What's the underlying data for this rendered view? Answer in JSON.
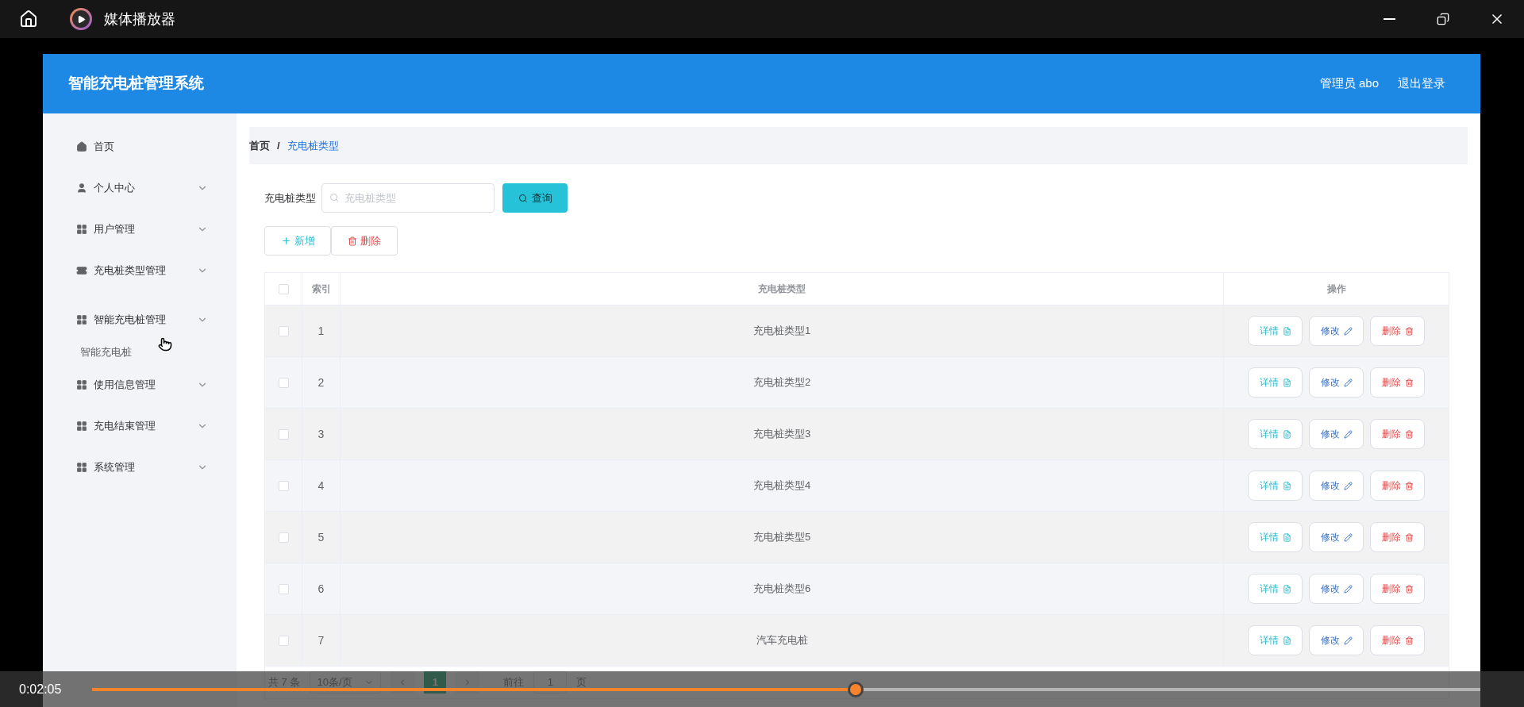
{
  "window": {
    "title": "媒体播放器"
  },
  "app": {
    "title": "智能充电桩管理系统",
    "user": "管理员 abo",
    "logout": "退出登录"
  },
  "sidebar": {
    "items": [
      {
        "label": "首页",
        "kind": "home"
      },
      {
        "label": "个人中心",
        "kind": "user"
      },
      {
        "label": "用户管理",
        "kind": "grid"
      },
      {
        "label": "充电桩类型管理",
        "kind": "ticket"
      },
      {
        "label": "智能充电桩管理",
        "kind": "grid",
        "children": [
          {
            "label": "智能充电桩"
          }
        ]
      },
      {
        "label": "使用信息管理",
        "kind": "grid"
      },
      {
        "label": "充电结束管理",
        "kind": "grid"
      },
      {
        "label": "系统管理",
        "kind": "grid"
      }
    ]
  },
  "breadcrumb": {
    "items": [
      "首页",
      "充电桩类型"
    ],
    "separator": "/"
  },
  "search": {
    "label": "充电桩类型",
    "placeholder": "充电桩类型",
    "button": "查询"
  },
  "actions": {
    "add": "新增",
    "delete": "删除"
  },
  "table": {
    "select_all": {
      "checked": false
    },
    "columns": [
      "索引",
      "充电桩类型",
      "操作"
    ],
    "rows": [
      {
        "checked": false,
        "index": "1",
        "type": "充电桩类型1",
        "buttons": [
          "详情",
          "修改",
          "删除"
        ]
      },
      {
        "checked": false,
        "index": "2",
        "type": "充电桩类型2",
        "buttons": [
          "详情",
          "修改",
          "删除"
        ]
      },
      {
        "checked": false,
        "index": "3",
        "type": "充电桩类型3",
        "buttons": [
          "详情",
          "修改",
          "删除"
        ]
      },
      {
        "checked": false,
        "index": "4",
        "type": "充电桩类型4",
        "buttons": [
          "详情",
          "修改",
          "删除"
        ]
      },
      {
        "checked": false,
        "index": "5",
        "type": "充电桩类型5",
        "buttons": [
          "详情",
          "修改",
          "删除"
        ]
      },
      {
        "checked": false,
        "index": "6",
        "type": "充电桩类型6",
        "buttons": [
          "详情",
          "修改",
          "删除"
        ]
      },
      {
        "checked": false,
        "index": "7",
        "type": "汽车充电桩",
        "buttons": [
          "详情",
          "修改",
          "删除"
        ]
      }
    ]
  },
  "pagination": {
    "total": "共 7 条",
    "page_size": "10条/页",
    "pages": [
      {
        "label": "1",
        "selected": true
      }
    ],
    "goto": "前往",
    "goto_value": "1",
    "goto_suffix": "页"
  },
  "player": {
    "time": "0:02:05",
    "level": 0.55
  }
}
